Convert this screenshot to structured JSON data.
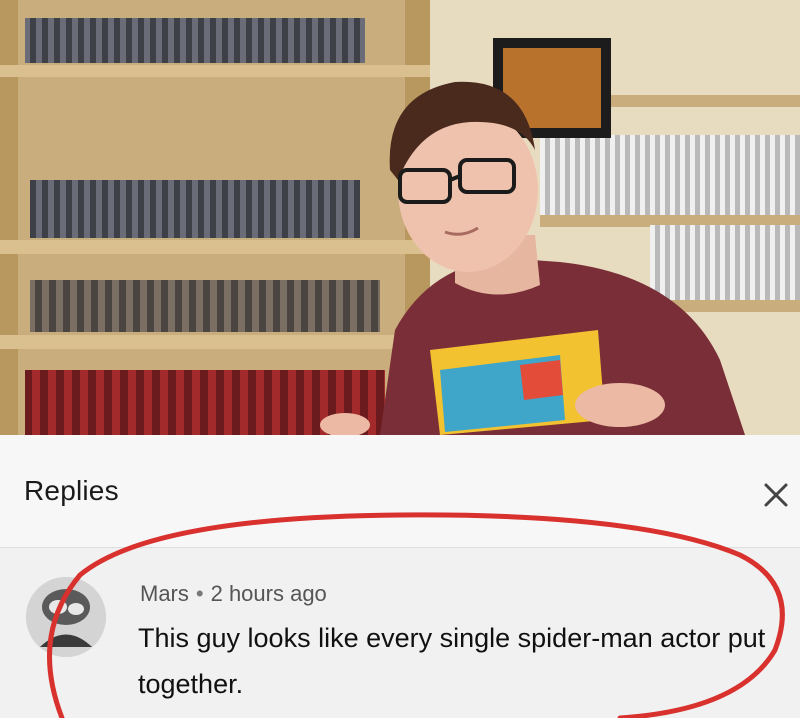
{
  "header": {
    "title": "Replies",
    "close_icon": "close-icon"
  },
  "comment": {
    "author": "Mars",
    "separator": "•",
    "time": "2 hours ago",
    "text": "This guy looks like every single spider-man actor put together.",
    "avatar_icon": "avatar"
  },
  "colors": {
    "annotation": "#d8312e",
    "sheet_bg": "#f1f1f1",
    "header_bg": "#f7f7f7",
    "text": "#111111",
    "meta_text": "#555555"
  }
}
